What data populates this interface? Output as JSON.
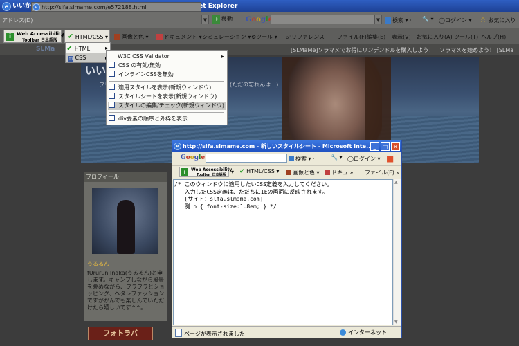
{
  "window": {
    "title": "いいかも。:WBC2連覇おめでとうセール。 - Microsoft Internet Explorer"
  },
  "address_bar": {
    "label": "アドレス(D)",
    "url": "http://slfa.slmame.com/e572188.html",
    "go_label": "移動"
  },
  "google_toolbar": {
    "search_label": "検索",
    "login_label": "ログイン",
    "favorites_label": "お気に入り"
  },
  "toolbar": {
    "wat_line1": "Web Accessibility",
    "wat_line2": "Toolbar 日本語版",
    "html_css": "HTML/CSS",
    "images_colors": "画像と色",
    "document": "ドキュメント",
    "simulation": "シミュレーション",
    "tools": "ツール",
    "references": "リファレンス",
    "file": "ファイル(F)",
    "edit": "編集(E)",
    "view": "表示(V)",
    "favorites": "お気に入り(A)",
    "ie_tools": "ツール(T)",
    "help": "ヘルプ(H)"
  },
  "menu_html_css": {
    "items": [
      "HTML",
      "CSS"
    ]
  },
  "menu_css": {
    "items": [
      "W3C CSS Validator",
      "CSS の有効/無効",
      "インラインCSSを無効",
      "適用スタイルを表示(新規ウィンドウ)",
      "スタイルシートを表示(新規ウィンドウ)",
      "スタイルの編集/チェック(新規ウィンドウ)",
      "div要素の順序と外枠を表示"
    ]
  },
  "webpage": {
    "logo": "SLMa",
    "marquee": "[SLMaMe]ソラマメでお得にリンデンドルを購入しよう！ | ソラマメを始めよう！ [SLMa",
    "banner_title": "いい",
    "banner_sub": "フリ",
    "banner_sub2": "(ただの忘れんは…)",
    "profile_heading": "プロフィール",
    "profile_name": "うるるん",
    "profile_text": "fUrurun Inaka(うるるん)と申します。キャンプしながら風景を眺めながら、フラフラとショッピング、ヘタレファッションですががんでも楽しんでいただけたら嬉しいです^^。",
    "photo_button": "フォトラバ"
  },
  "popup": {
    "title": "http://slfa.slmame.com - 新しいスタイルシート - Microsoft Inte...",
    "search_label": "検索",
    "login_label": "ログイン",
    "html_css": "HTML/CSS",
    "images_colors": "画像と色",
    "doc": "ドキュ",
    "file": "ファイル(F)",
    "textarea_lines": [
      "/* このウィンドウに適用したいCSS定義を入力してください。",
      "   入力したCSS定義は、ただちにIEの画面に反映されます。",
      "   [サイト：slfa.slmame.com]",
      "   例 p { font-size:1.8em; } */"
    ],
    "status_text": "ページが表示されました",
    "zone_text": "インターネット"
  }
}
